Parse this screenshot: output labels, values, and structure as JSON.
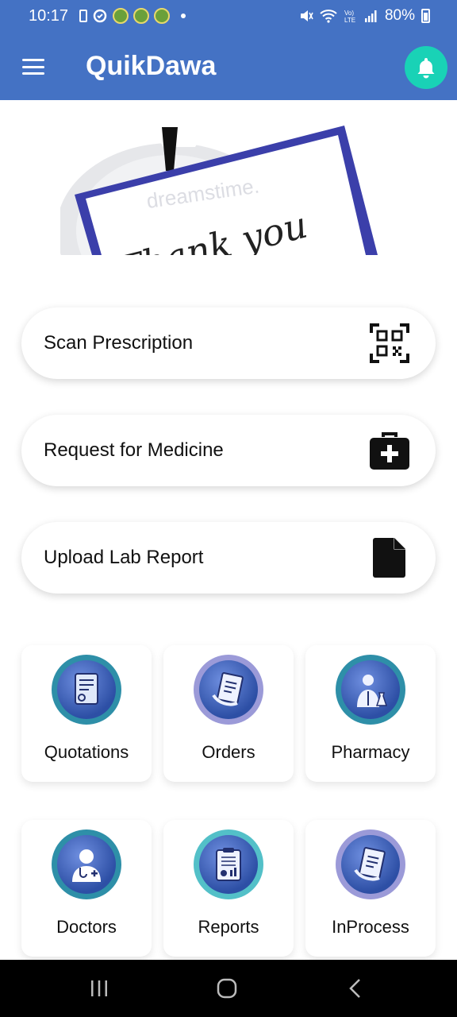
{
  "status_bar": {
    "time": "10:17",
    "battery": "80%"
  },
  "app_bar": {
    "title": "QuikDawa"
  },
  "banner": {
    "text": "Thank you",
    "watermark": "dreamstime."
  },
  "actions": [
    {
      "label": "Scan Prescription",
      "icon": "qr-code-icon"
    },
    {
      "label": "Request for Medicine",
      "icon": "medical-kit-icon"
    },
    {
      "label": "Upload Lab Report",
      "icon": "document-icon"
    }
  ],
  "tiles": [
    {
      "label": "Quotations",
      "icon": "quotation-document-icon",
      "ring": "#2e8fa8"
    },
    {
      "label": "Orders",
      "icon": "orders-clipboard-icon",
      "ring": "#9b9ad8"
    },
    {
      "label": "Pharmacy",
      "icon": "pharmacist-icon",
      "ring": "#2e8fa8"
    },
    {
      "label": "Doctors",
      "icon": "doctor-icon",
      "ring": "#2e8fa8"
    },
    {
      "label": "Reports",
      "icon": "reports-clipboard-icon",
      "ring": "#53c0c8"
    },
    {
      "label": "InProcess",
      "icon": "inprocess-clipboard-icon",
      "ring": "#9b9ad8"
    }
  ],
  "colors": {
    "app_bar": "#4472c4",
    "bell_button": "#19d2b6"
  }
}
